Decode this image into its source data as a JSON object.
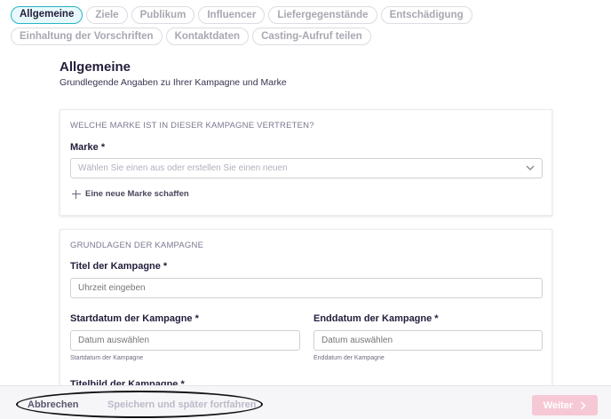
{
  "tabs": [
    {
      "label": "Allgemeine",
      "active": true
    },
    {
      "label": "Ziele"
    },
    {
      "label": "Publikum"
    },
    {
      "label": "Influencer"
    },
    {
      "label": "Liefergegenstände"
    },
    {
      "label": "Entschädigung"
    },
    {
      "label": "Einhaltung der Vorschriften"
    },
    {
      "label": "Kontaktdaten"
    },
    {
      "label": "Casting-Aufruf teilen"
    }
  ],
  "header": {
    "title": "Allgemeine",
    "subtitle": "Grundlegende Angaben zu Ihrer Kampagne und Marke"
  },
  "brand_section": {
    "heading": "WELCHE MARKE IST IN DIESER KAMPAGNE VERTRETEN?",
    "brand_label": "Marke *",
    "brand_placeholder": "Wählen Sie einen aus oder erstellen Sie einen neuen",
    "add_brand": "Eine neue Marke schaffen"
  },
  "campaign_section": {
    "heading": "GRUNDLAGEN DER KAMPAGNE",
    "title_label": "Titel der Kampagne *",
    "title_placeholder": "Uhrzeit eingeben",
    "start_label": "Startdatum der Kampagne *",
    "start_placeholder": "Datum auswählen",
    "start_help": "Startdatum der Kampagne",
    "end_label": "Enddatum der Kampagne *",
    "end_placeholder": "Datum auswählen",
    "end_help": "Enddatum der Kampagne",
    "cover_label": "Titelbild der Kampagne *"
  },
  "footer": {
    "cancel": "Abbrechen",
    "save_later": "Speichern und später fortfahren",
    "next": "Weiter"
  }
}
